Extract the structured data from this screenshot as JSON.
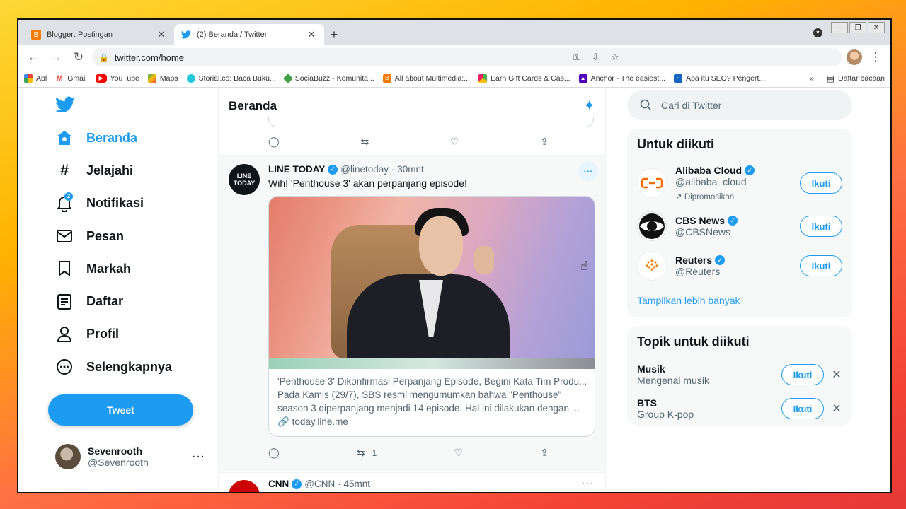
{
  "browser": {
    "tabs": [
      {
        "title": "Blogger: Postingan",
        "active": false,
        "icon": "blogger-icon"
      },
      {
        "title": "(2) Beranda / Twitter",
        "active": true,
        "icon": "twitter-icon"
      }
    ],
    "url": "twitter.com/home",
    "bookmarks": [
      {
        "label": "Apl",
        "icon": "apps-grid-icon"
      },
      {
        "label": "Gmail",
        "icon": "gmail-icon"
      },
      {
        "label": "YouTube",
        "icon": "youtube-icon"
      },
      {
        "label": "Maps",
        "icon": "maps-icon"
      },
      {
        "label": "Storial.co: Baca Buku...",
        "icon": "storial-icon"
      },
      {
        "label": "SociaBuzz - Komunita...",
        "icon": "sociabuzz-icon"
      },
      {
        "label": "All about Multimedia:...",
        "icon": "blogger-icon"
      },
      {
        "label": "Earn Gift Cards & Cas...",
        "icon": "giftcard-icon"
      },
      {
        "label": "Anchor - The easiest...",
        "icon": "anchor-icon"
      },
      {
        "label": "Apa itu SEO? Pengert...",
        "icon": "seo-icon"
      }
    ],
    "reading_list": "Daftar bacaan"
  },
  "nav": {
    "items": [
      {
        "label": "Beranda",
        "icon": "home-icon",
        "active": true
      },
      {
        "label": "Jelajahi",
        "icon": "hashtag-icon"
      },
      {
        "label": "Notifikasi",
        "icon": "bell-icon",
        "badge": "2"
      },
      {
        "label": "Pesan",
        "icon": "mail-icon"
      },
      {
        "label": "Markah",
        "icon": "bookmark-icon"
      },
      {
        "label": "Daftar",
        "icon": "list-icon"
      },
      {
        "label": "Profil",
        "icon": "person-icon"
      },
      {
        "label": "Selengkapnya",
        "icon": "more-circle-icon"
      }
    ],
    "tweet_button": "Tweet",
    "profile": {
      "name": "Sevenrooth",
      "handle": "@Sevenrooth"
    }
  },
  "timeline": {
    "title": "Beranda",
    "tweet": {
      "avatar_text": "LINE TODAY",
      "name": "LINE TODAY",
      "handle": "@linetoday",
      "time": "· 30mnt",
      "text": "Wih! 'Penthouse 3' akan perpanjang episode!",
      "card": {
        "title": "'Penthouse 3' Dikonfirmasi Perpanjang Episode, Begini Kata Tim Produ...",
        "description": "Pada Kamis (29/7), SBS resmi mengumumkan bahwa \"Penthouse\" season 3 diperpanjang menjadi 14 episode. Hal ini dilakukan dengan ...",
        "link": "today.line.me"
      },
      "retweets": "1"
    },
    "next_tweet": {
      "name": "CNN",
      "handle": "@CNN",
      "time": "· 45mnt"
    }
  },
  "sidebar": {
    "search_placeholder": "Cari di Twitter",
    "who_to_follow": {
      "title": "Untuk diikuti",
      "accounts": [
        {
          "name": "Alibaba Cloud",
          "handle": "@alibaba_cloud",
          "promoted": "Dipromosikan"
        },
        {
          "name": "CBS News",
          "handle": "@CBSNews"
        },
        {
          "name": "Reuters",
          "handle": "@Reuters"
        }
      ],
      "follow_label": "Ikuti",
      "show_more": "Tampilkan lebih banyak"
    },
    "topics": {
      "title": "Topik untuk diikuti",
      "items": [
        {
          "name": "Musik",
          "desc": "Mengenai musik"
        },
        {
          "name": "BTS",
          "desc": "Group K-pop"
        }
      ]
    }
  },
  "colors": {
    "twitter_blue": "#1d9bf0",
    "text": "#0f1419",
    "muted": "#536471"
  }
}
